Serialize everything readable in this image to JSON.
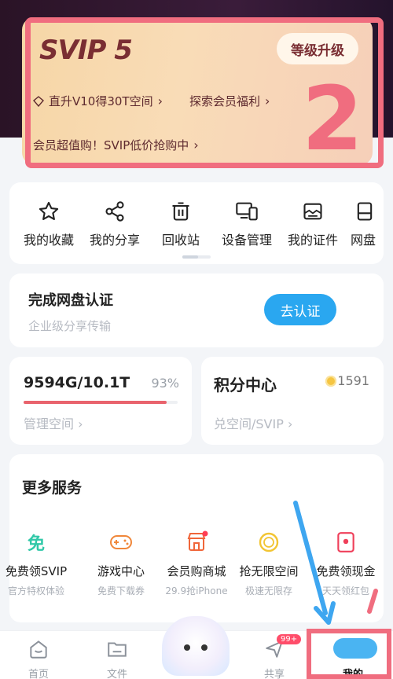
{
  "svip_card": {
    "logo": "SVIP 5",
    "upgrade_label": "等级升级",
    "perk_left": "直升V10得30T空间",
    "perk_right": "探索会员福利",
    "promo": "会员超值购！SVIP低价抢购中",
    "chevron": "›"
  },
  "annotations": {
    "number": "2",
    "color": "#f06d7f",
    "pointer_color": "#3ea6f0"
  },
  "quick_actions": [
    {
      "label": "我的收藏",
      "icon": "star-icon"
    },
    {
      "label": "我的分享",
      "icon": "share-icon"
    },
    {
      "label": "回收站",
      "icon": "trash-icon"
    },
    {
      "label": "设备管理",
      "icon": "devices-icon"
    },
    {
      "label": "我的证件",
      "icon": "id-card-icon"
    },
    {
      "label": "网盘",
      "icon": "disk-icon"
    }
  ],
  "verify": {
    "title": "完成网盘认证",
    "subtitle": "企业级分享传输",
    "button": "去认证"
  },
  "storage": {
    "value": "9594G/10.1T",
    "percent": "93%",
    "percent_num": 93,
    "link": "管理空间"
  },
  "points": {
    "title": "积分中心",
    "value": "1591",
    "link": "兑空间/SVIP"
  },
  "more_services": {
    "title": "更多服务",
    "items": [
      {
        "label": "免费领SVIP",
        "sub": "官方特权体验",
        "icon": "free-icon",
        "glyph": "免"
      },
      {
        "label": "游戏中心",
        "sub": "免费下载券",
        "icon": "gamepad-icon"
      },
      {
        "label": "会员购商城",
        "sub": "29.9抢iPhone",
        "icon": "shop-icon"
      },
      {
        "label": "抢无限空间",
        "sub": "极速无限存",
        "icon": "infinite-icon"
      },
      {
        "label": "免费领现金",
        "sub": "天天领红包",
        "icon": "redpacket-icon"
      }
    ]
  },
  "tabbar": {
    "tabs": [
      {
        "label": "首页",
        "icon": "home-icon"
      },
      {
        "label": "文件",
        "icon": "folder-icon"
      },
      {
        "label": "共享",
        "icon": "send-icon",
        "badge": "99+"
      },
      {
        "label": "我的",
        "icon": "me-icon",
        "active": true
      }
    ]
  }
}
